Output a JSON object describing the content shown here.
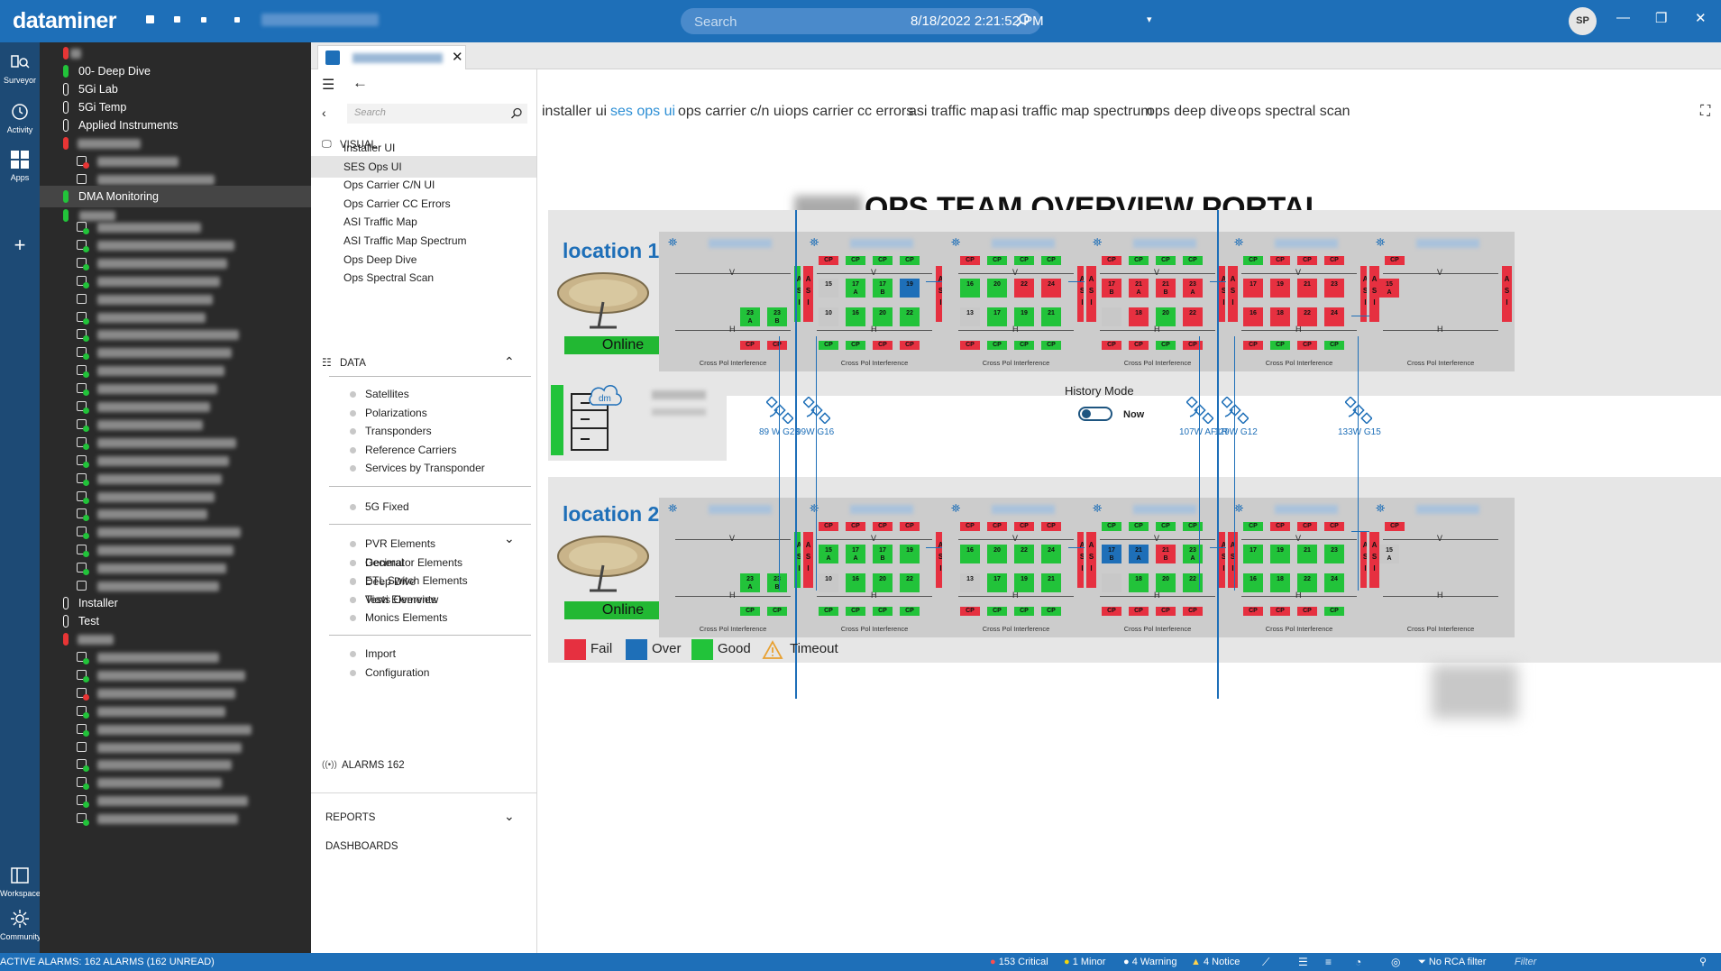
{
  "app": {
    "brand": "dataminer",
    "search_placeholder": "Search",
    "datetime": "8/18/2022 2:21:52 PM",
    "user_initials": "SP"
  },
  "rail": [
    {
      "label": "Surveyor",
      "icon": "surveyor-icon"
    },
    {
      "label": "Activity",
      "icon": "activity-icon"
    },
    {
      "label": "Apps",
      "icon": "apps-icon"
    },
    {
      "label": "Workspace",
      "icon": "workspace-icon"
    },
    {
      "label": "Community",
      "icon": "community-icon"
    }
  ],
  "tree": {
    "deep_dive": "00- Deep Dive",
    "lab": "5Gi Lab",
    "temp": "5Gi Temp",
    "applied": "Applied Instruments",
    "dma": "DMA Monitoring",
    "installer": "Installer",
    "test": "Test"
  },
  "nav": {
    "search_placeholder": "Search",
    "visual_header": "VISUAL",
    "visual_items": [
      "Installer UI",
      "SES Ops UI",
      "Ops Carrier C/N UI",
      "Ops Carrier CC Errors",
      "ASI Traffic Map",
      "ASI Traffic Map Spectrum",
      "Ops Deep Dive",
      "Ops Spectral Scan"
    ],
    "data_header": "DATA",
    "data_group1": [
      "General",
      "Deep Dive",
      "Tests Overview"
    ],
    "data_group2": [
      "Satellites",
      "Polarizations",
      "Transponders",
      "Reference Carriers",
      "Services by Transponder"
    ],
    "data_group3": [
      "5G Fixed"
    ],
    "data_group4": [
      "PVR Elements",
      "Decimator Elements",
      "ETL Switch Elements",
      "Viavi Elements",
      "Monics Elements"
    ],
    "data_group5": [
      "Import",
      "Configuration"
    ],
    "alarms_label": "ALARMS",
    "alarms_count": "162",
    "reports": "REPORTS",
    "dashboards": "DASHBOARDS"
  },
  "page_tabs": [
    "installer ui",
    "ses ops ui",
    "ops carrier c/n ui",
    "ops carrier cc errors",
    "asi traffic map",
    "asi traffic map spectrum",
    "ops deep dive",
    "ops spectral scan"
  ],
  "active_page_tab": "ses ops ui",
  "portal": {
    "title": "OPS TEAM OVERVIEW PORTAL",
    "location1": "location 1",
    "location2": "location 2",
    "online": "Online",
    "history_mode": "History Mode",
    "history_toggle": "Now",
    "panel_footer": "Cross Pol Interference",
    "cp": "CP",
    "asi": "A S I",
    "v": "V",
    "h": "H",
    "satellites": [
      "89 W G28",
      "99W G16",
      "107W AF1R",
      "129W G12",
      "133W G15"
    ]
  },
  "legend": {
    "fail": "Fail",
    "over": "Over",
    "good": "Good",
    "timeout": "Timeout"
  },
  "colors": {
    "fail": "#e63040",
    "over": "#1e6fb8",
    "good": "#22c33a",
    "accent": "#1e6fb8"
  },
  "status": {
    "active_alarms": "ACTIVE ALARMS: 162 ALARMS (162 UNREAD)",
    "critical": "153 Critical",
    "minor": "1 Minor",
    "warning": "4 Warning",
    "notice": "4 Notice",
    "rca": "No RCA filter",
    "filter_placeholder": "Filter"
  }
}
